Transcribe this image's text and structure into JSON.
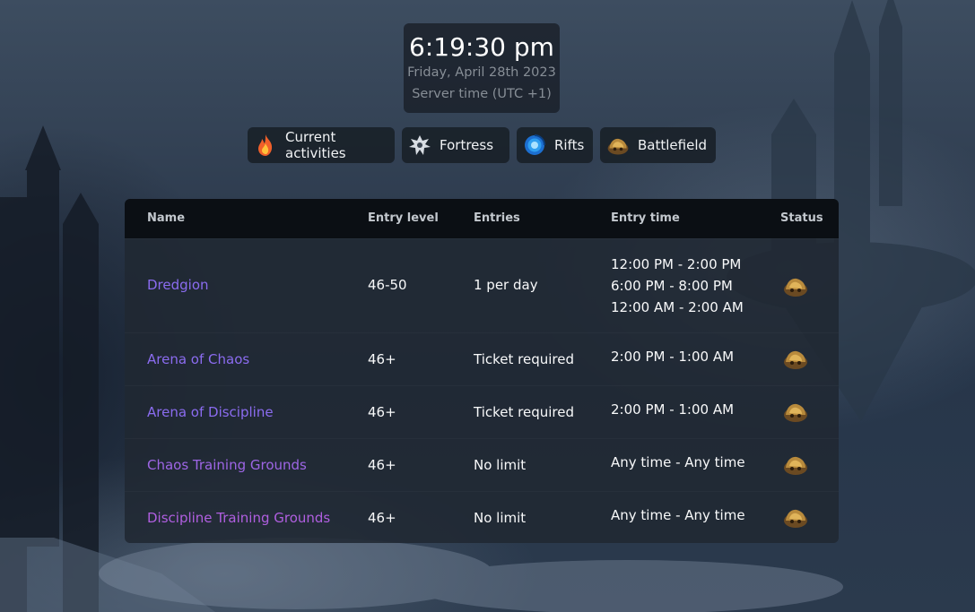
{
  "clock": {
    "time": "6:19:30 pm",
    "date": "Friday, April 28th 2023",
    "timezone": "Server time (UTC +1)"
  },
  "nav": [
    {
      "label": "Current activities",
      "icon": "fire-icon"
    },
    {
      "label": "Fortress",
      "icon": "fortress-emblem-icon"
    },
    {
      "label": "Rifts",
      "icon": "rift-portal-icon"
    },
    {
      "label": "Battlefield",
      "icon": "battlefield-icon"
    }
  ],
  "table": {
    "headers": {
      "name": "Name",
      "level": "Entry level",
      "entries": "Entries",
      "time": "Entry time",
      "status": "Status"
    },
    "rows": [
      {
        "name": "Dredgion",
        "level": "46-50",
        "entries": "1 per day",
        "times": [
          "12:00 PM - 2:00 PM",
          "6:00 PM - 8:00 PM",
          "12:00 AM - 2:00 AM"
        ],
        "status_icon": "battlefield-icon"
      },
      {
        "name": "Arena of Chaos",
        "level": "46+",
        "entries": "Ticket required",
        "times": [
          "2:00 PM - 1:00 AM"
        ],
        "status_icon": "battlefield-icon"
      },
      {
        "name": "Arena of Discipline",
        "level": "46+",
        "entries": "Ticket required",
        "times": [
          "2:00 PM - 1:00 AM"
        ],
        "status_icon": "battlefield-icon"
      },
      {
        "name": "Chaos Training Grounds",
        "level": "46+",
        "entries": "No limit",
        "times": [
          "Any time - Any time"
        ],
        "status_icon": "battlefield-icon"
      },
      {
        "name": "Discipline Training Grounds",
        "level": "46+",
        "entries": "No limit",
        "times": [
          "Any time - Any time"
        ],
        "status_icon": "battlefield-icon"
      }
    ]
  },
  "colors": {
    "link_purple": "#8b6cf0",
    "link_pink": "#b05fe0",
    "card_bg": "#202832",
    "header_bg": "#0b0f14"
  }
}
